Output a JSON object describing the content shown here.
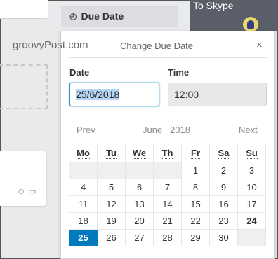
{
  "due_button": {
    "label": "Due Date",
    "icon": "clock-icon"
  },
  "dark_strip": {
    "text": "To Skype"
  },
  "watermark": "groovyPost.com",
  "popover": {
    "title": "Change Due Date",
    "close_glyph": "×"
  },
  "date": {
    "label": "Date",
    "value": "25/6/2018"
  },
  "time": {
    "label": "Time",
    "value": "12:00"
  },
  "calendar": {
    "prev": "Prev",
    "month": "June",
    "year": "2018",
    "next": "Next",
    "weekdays": [
      "Mo",
      "Tu",
      "We",
      "Th",
      "Fr",
      "Sa",
      "Su"
    ],
    "weeks": [
      [
        "",
        "",
        "",
        "",
        "1",
        "2",
        "3"
      ],
      [
        "4",
        "5",
        "6",
        "7",
        "8",
        "9",
        "10"
      ],
      [
        "11",
        "12",
        "13",
        "14",
        "15",
        "16",
        "17"
      ],
      [
        "18",
        "19",
        "20",
        "21",
        "22",
        "23",
        "24"
      ],
      [
        "25",
        "26",
        "27",
        "28",
        "29",
        "30",
        ""
      ]
    ],
    "today": "24",
    "selected": "25"
  },
  "colors": {
    "accent": "#0079bf",
    "focus_border": "#298fca"
  }
}
